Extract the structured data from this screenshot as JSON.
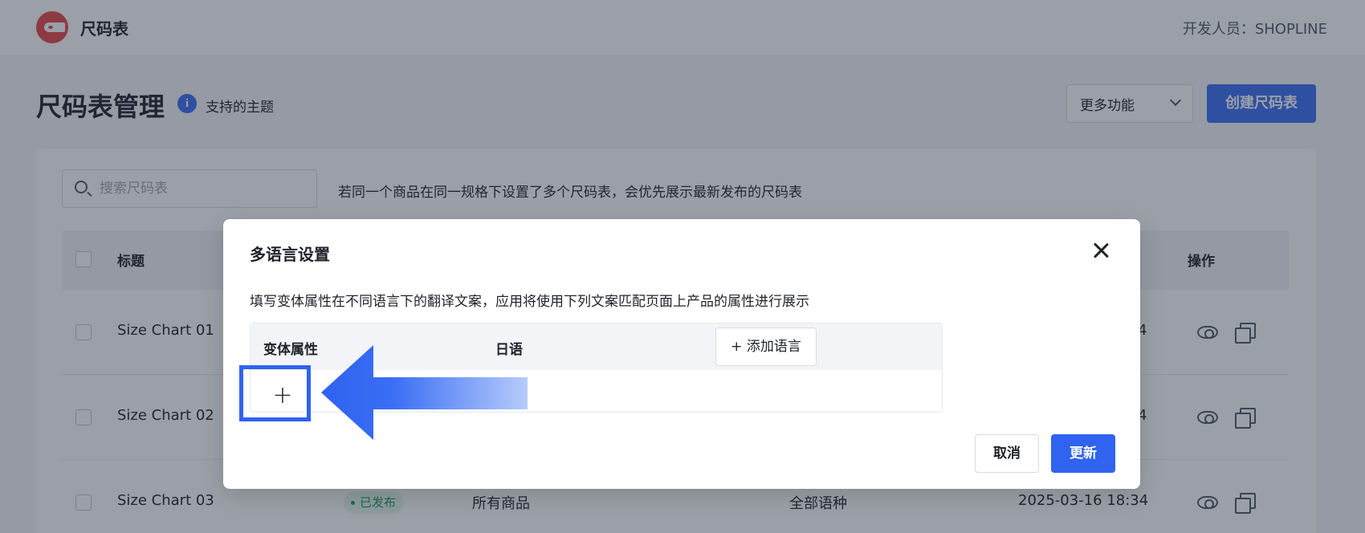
{
  "app": {
    "name": "尺码表",
    "developer": "开发人员：SHOPLINE"
  },
  "page": {
    "title": "尺码表管理",
    "themes_link": "支持的主题",
    "info_icon_glyph": "i",
    "more_select": "更多功能",
    "create_button": "创建尺码表"
  },
  "toolbar": {
    "search_placeholder": "搜索尺码表",
    "hint": "若同一个商品在同一规格下设置了多个尺码表，会优先展示最新发布的尺码表"
  },
  "table": {
    "headers": {
      "title": "标题",
      "actions": "操作"
    },
    "rows": [
      {
        "title": "Size Chart 01",
        "status": "",
        "products": "",
        "languages": "",
        "time": "4"
      },
      {
        "title": "Size Chart 02",
        "status": "",
        "products": "",
        "languages": "",
        "time": "4"
      },
      {
        "title": "Size Chart 03",
        "status": "已发布",
        "products": "所有商品",
        "languages": "全部语种",
        "time": "2025-03-16 18:34"
      }
    ]
  },
  "modal": {
    "title": "多语言设置",
    "description": "填写变体属性在不同语言下的翻译文案，应用将使用下列文案匹配页面上产品的属性进行展示",
    "columns": {
      "variant_attr": "变体属性",
      "language": "日语"
    },
    "add_language": "+ 添加语言",
    "add_row_glyph": "+",
    "cancel": "取消",
    "update": "更新"
  },
  "colors": {
    "primary": "#2f63f0",
    "highlight": "#2f63f0",
    "arrow": "#3b6ef5"
  }
}
